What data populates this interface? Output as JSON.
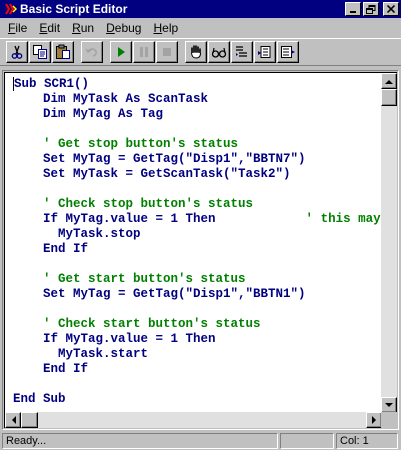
{
  "window": {
    "title": "Basic Script Editor"
  },
  "menu": [
    {
      "label": "File",
      "key": "F",
      "rest": "ile"
    },
    {
      "label": "Edit",
      "key": "E",
      "rest": "dit"
    },
    {
      "label": "Run",
      "key": "R",
      "rest": "un"
    },
    {
      "label": "Debug",
      "key": "D",
      "rest": "ebug"
    },
    {
      "label": "Help",
      "key": "H",
      "rest": "elp"
    }
  ],
  "toolbar": [
    {
      "name": "cut-button",
      "icon": "scissors-icon"
    },
    {
      "name": "copy-button",
      "icon": "copy-icon"
    },
    {
      "name": "paste-button",
      "icon": "paste-icon"
    },
    {
      "name": "undo-button",
      "icon": "undo-icon",
      "disabled": true
    },
    {
      "name": "run-button",
      "icon": "play-icon"
    },
    {
      "name": "pause-button",
      "icon": "pause-icon",
      "disabled": true
    },
    {
      "name": "stop-button",
      "icon": "stop-icon",
      "disabled": true
    },
    {
      "name": "toggle-breakpoint-button",
      "icon": "hand-icon"
    },
    {
      "name": "watch-button",
      "icon": "glasses-icon"
    },
    {
      "name": "step-into-button",
      "icon": "step-into-icon"
    },
    {
      "name": "step-over-button",
      "icon": "step-over-icon"
    },
    {
      "name": "step-out-button",
      "icon": "step-out-icon"
    }
  ],
  "code": {
    "lines": [
      {
        "text": "Sub SCR1()",
        "type": "code"
      },
      {
        "text": "    Dim MyTask As ScanTask",
        "type": "code"
      },
      {
        "text": "    Dim MyTag As Tag",
        "type": "code"
      },
      {
        "text": "",
        "type": "code"
      },
      {
        "text": "    ' Get stop button's status",
        "type": "comment"
      },
      {
        "text": "    Set MyTag = GetTag(\"Disp1\",\"BBTN7\")",
        "type": "code"
      },
      {
        "text": "    Set MyTask = GetScanTask(\"Task2\")",
        "type": "code"
      },
      {
        "text": "",
        "type": "code"
      },
      {
        "text": "    ' Check stop button's status",
        "type": "comment"
      },
      {
        "text": "    If MyTag.value = 1 Then",
        "type": "code",
        "trailing_comment": "            ' this may"
      },
      {
        "text": "      MyTask.stop",
        "type": "code"
      },
      {
        "text": "    End If",
        "type": "code"
      },
      {
        "text": "",
        "type": "code"
      },
      {
        "text": "    ' Get start button's status",
        "type": "comment"
      },
      {
        "text": "    Set MyTag = GetTag(\"Disp1\",\"BBTN1\")",
        "type": "code"
      },
      {
        "text": "",
        "type": "code"
      },
      {
        "text": "    ' Check start button's status",
        "type": "comment"
      },
      {
        "text": "    If MyTag.value = 1 Then",
        "type": "code"
      },
      {
        "text": "      MyTask.start",
        "type": "code"
      },
      {
        "text": "    End If",
        "type": "code"
      },
      {
        "text": "",
        "type": "code"
      },
      {
        "text": "End Sub",
        "type": "code"
      }
    ]
  },
  "status": {
    "message": "Ready...",
    "column": "Col: 1"
  },
  "colors": {
    "code": "#000080",
    "comment": "#008000",
    "titlebar": "#000080"
  }
}
